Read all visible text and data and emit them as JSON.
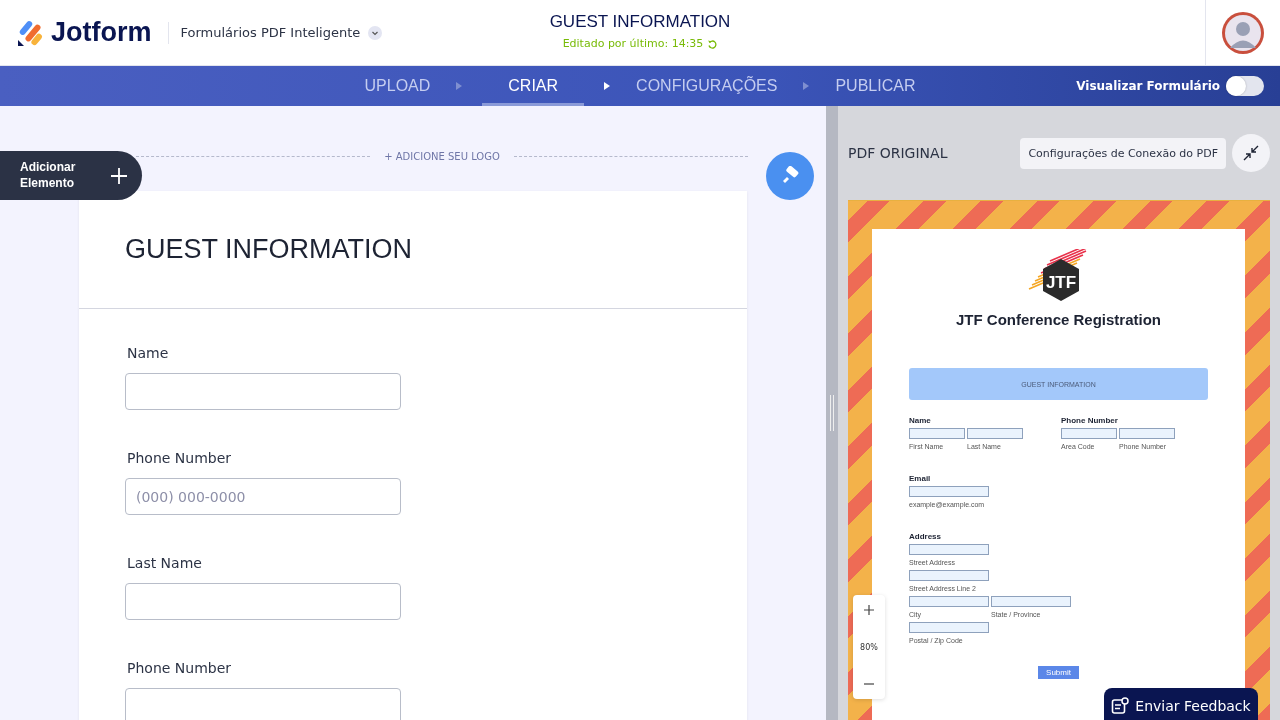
{
  "header": {
    "brand": "Jotform",
    "product": "Formulários PDF Inteligente",
    "title": "GUEST INFORMATION",
    "last_edited": "Editado por último: 14:35"
  },
  "steps": [
    {
      "label": "UPLOAD",
      "selected": false
    },
    {
      "label": "CRIAR",
      "selected": true
    },
    {
      "label": "CONFIGURAÇÕES",
      "selected": false
    },
    {
      "label": "PUBLICAR",
      "selected": false
    }
  ],
  "preview_toggle": {
    "label": "Visualizar Formulário",
    "on": false
  },
  "builder": {
    "add_element": "Adicionar Elemento",
    "logo_placeholder": "+ ADICIONE SEU LOGO",
    "form_title": "GUEST INFORMATION",
    "fields": [
      {
        "label": "Name"
      },
      {
        "label": "Phone Number",
        "placeholder": "(000) 000-0000"
      },
      {
        "label": "Last Name"
      },
      {
        "label": "Phone Number"
      }
    ]
  },
  "pdf_panel": {
    "heading": "PDF ORIGINAL",
    "connection_button": "Configurações de Conexão do PDF",
    "zoom": "80%",
    "feedback_button": "Enviar Feedback",
    "document": {
      "logo_text": "JTF",
      "title": "JTF Conference Registration",
      "section": "GUEST INFORMATION",
      "rows": [
        [
          {
            "label": "Name",
            "inputs": [
              [
                "First Name",
                "Last Name"
              ]
            ]
          },
          {
            "label": "Phone Number",
            "inputs": [
              [
                "Area Code",
                "Phone Number"
              ]
            ]
          }
        ],
        [
          {
            "label": "Email",
            "inputs": [
              [
                "example@example.com"
              ]
            ]
          }
        ],
        [
          {
            "label": "Address",
            "inputs": [
              [
                "Street Address"
              ],
              [
                "Street Address Line 2"
              ],
              [
                "City",
                "State / Province"
              ],
              [
                "Postal / Zip Code"
              ]
            ]
          }
        ]
      ],
      "submit": "Submit"
    }
  }
}
